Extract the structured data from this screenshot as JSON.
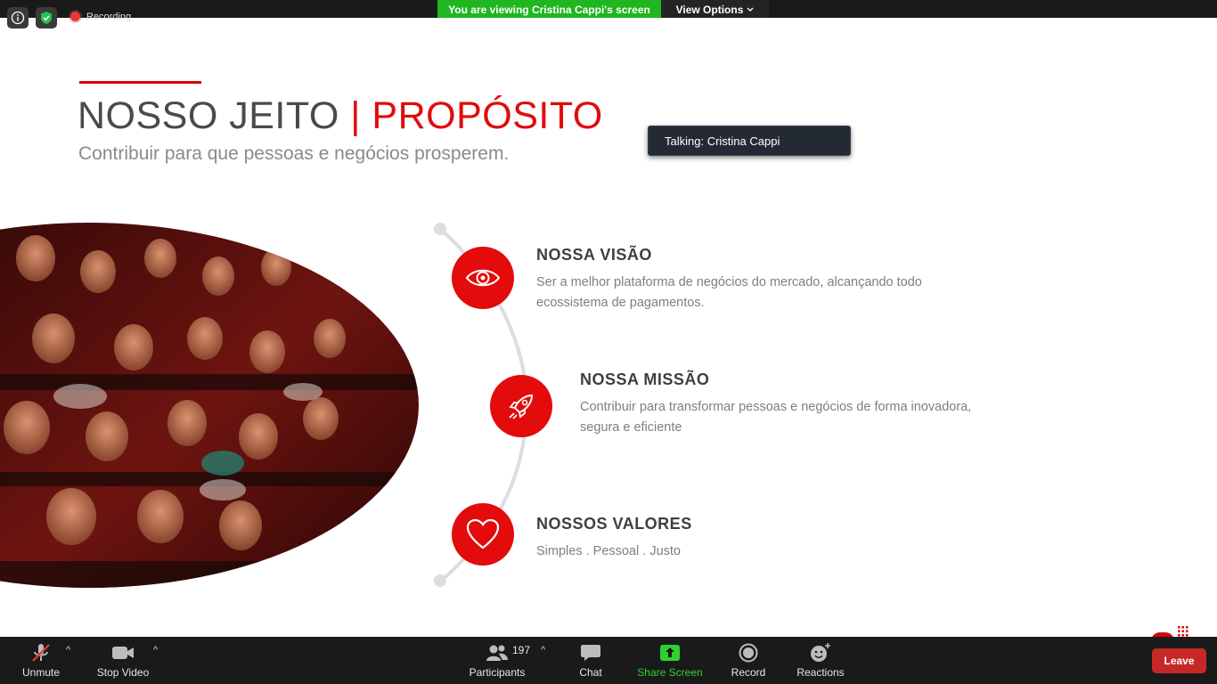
{
  "top": {
    "recording_label": "Recording",
    "viewing_banner": "You are viewing Cristina Cappi's screen",
    "view_options_label": "View Options"
  },
  "slide": {
    "title_part1": "NOSSO JEITO ",
    "title_part2": "| PROPÓSITO",
    "subtitle": "Contribuir para que pessoas e negócios prosperem.",
    "items": [
      {
        "title": "NOSSA VISÃO",
        "text": "Ser a melhor plataforma de negócios do mercado, alcançando todo ecossistema de pagamentos.",
        "icon": "eye-icon"
      },
      {
        "title": "NOSSA MISSÃO",
        "text": "Contribuir para transformar pessoas e negócios de forma inovadora, segura e eficiente",
        "icon": "rocket-icon"
      },
      {
        "title": "NOSSOS VALORES",
        "text": "Simples . Pessoal . Justo",
        "icon": "heart-icon"
      }
    ]
  },
  "talking_label": "Talking: Cristina Cappi",
  "toolbar": {
    "unmute": "Unmute",
    "stop_video": "Stop Video",
    "participants": "Participants",
    "participants_count": "197",
    "chat": "Chat",
    "share_screen": "Share Screen",
    "record": "Record",
    "reactions": "Reactions",
    "leave": "Leave"
  },
  "colors": {
    "accent_red": "#e10b0b",
    "share_green": "#1fb61f",
    "leave_red": "#c62828"
  }
}
